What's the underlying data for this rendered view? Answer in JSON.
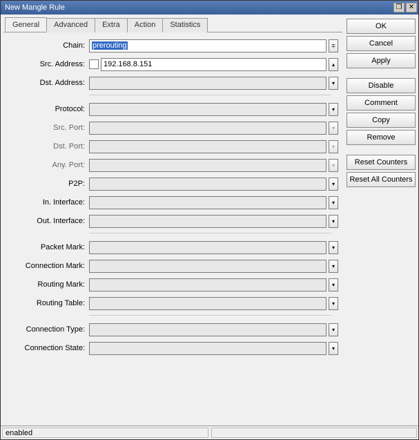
{
  "window": {
    "title": "New Mangle Rule"
  },
  "tabs": [
    "General",
    "Advanced",
    "Extra",
    "Action",
    "Statistics"
  ],
  "active_tab": 0,
  "labels": {
    "chain": "Chain:",
    "src_addr": "Src. Address:",
    "dst_addr": "Dst. Address:",
    "protocol": "Protocol:",
    "src_port": "Src. Port:",
    "dst_port": "Dst. Port:",
    "any_port": "Any. Port:",
    "p2p": "P2P:",
    "in_if": "In. Interface:",
    "out_if": "Out. Interface:",
    "packet_mark": "Packet Mark:",
    "conn_mark": "Connection Mark:",
    "routing_mark": "Routing Mark:",
    "routing_table": "Routing Table:",
    "conn_type": "Connection Type:",
    "conn_state": "Connection State:"
  },
  "values": {
    "chain": "prerouting",
    "src_addr": "192.168.8.151",
    "dst_addr": "",
    "protocol": "",
    "src_port": "",
    "dst_port": "",
    "any_port": "",
    "p2p": "",
    "in_if": "",
    "out_if": "",
    "packet_mark": "",
    "conn_mark": "",
    "routing_mark": "",
    "routing_table": "",
    "conn_type": "",
    "conn_state": ""
  },
  "buttons": {
    "ok": "OK",
    "cancel": "Cancel",
    "apply": "Apply",
    "disable": "Disable",
    "comment": "Comment",
    "copy": "Copy",
    "remove": "Remove",
    "reset_counters": "Reset Counters",
    "reset_all": "Reset All Counters"
  },
  "status": {
    "left": "enabled",
    "right": ""
  }
}
